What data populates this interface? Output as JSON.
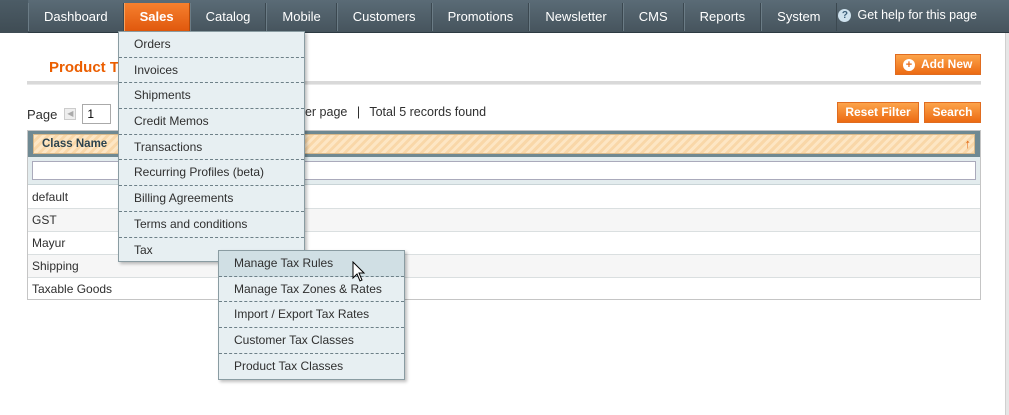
{
  "nav": {
    "items": [
      {
        "label": "Dashboard"
      },
      {
        "label": "Sales"
      },
      {
        "label": "Catalog"
      },
      {
        "label": "Mobile"
      },
      {
        "label": "Customers"
      },
      {
        "label": "Promotions"
      },
      {
        "label": "Newsletter"
      },
      {
        "label": "CMS"
      },
      {
        "label": "Reports"
      },
      {
        "label": "System"
      }
    ],
    "active": "Sales",
    "help_label": "Get help for this page",
    "help_icon": "question-icon"
  },
  "page": {
    "title": "Product T",
    "add_new_label": "Add New",
    "reset_filter_label": "Reset Filter",
    "search_label": "Search"
  },
  "pager": {
    "page_label": "Page",
    "page_value": "1",
    "per_page_text": "per page",
    "separator": "|",
    "records_text": "Total 5 records found"
  },
  "grid": {
    "column_header": "Class Name",
    "sort_indicator": "↑",
    "filter_value": "",
    "rows": [
      {
        "name": "default"
      },
      {
        "name": "GST"
      },
      {
        "name": "Mayur"
      },
      {
        "name": "Shipping"
      },
      {
        "name": "Taxable Goods"
      }
    ]
  },
  "sales_menu": {
    "items": [
      {
        "label": "Orders"
      },
      {
        "label": "Invoices"
      },
      {
        "label": "Shipments"
      },
      {
        "label": "Credit Memos"
      },
      {
        "label": "Transactions"
      },
      {
        "label": "Recurring Profiles (beta)"
      },
      {
        "label": "Billing Agreements"
      },
      {
        "label": "Terms and conditions"
      },
      {
        "label": "Tax"
      }
    ]
  },
  "tax_menu": {
    "items": [
      {
        "label": "Manage Tax Rules"
      },
      {
        "label": "Manage Tax Zones & Rates"
      },
      {
        "label": "Import / Export Tax Rates"
      },
      {
        "label": "Customer Tax Classes"
      },
      {
        "label": "Product Tax Classes"
      }
    ]
  },
  "colors": {
    "accent": "#eb5e00",
    "nav_bg": "#4f5f69",
    "menu_bg": "#e7eff2"
  }
}
